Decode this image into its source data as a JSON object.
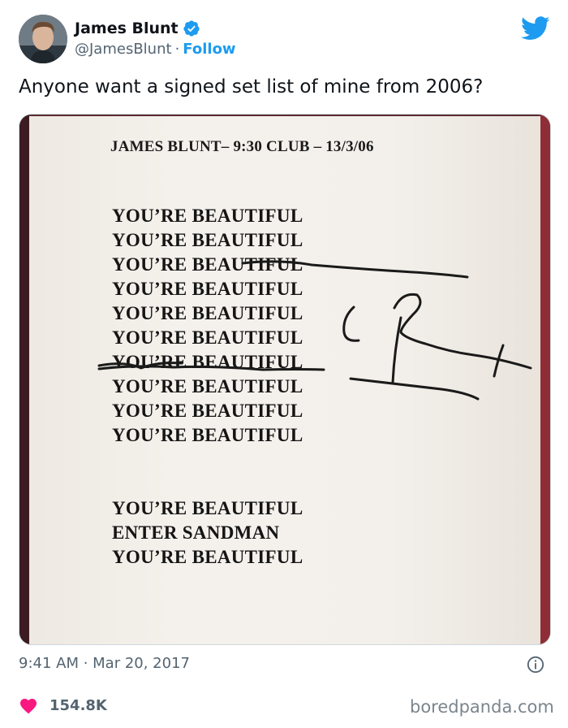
{
  "tweet": {
    "author_name": "James Blunt",
    "handle": "@JamesBlunt",
    "separator": "·",
    "follow_label": "Follow",
    "text": "Anyone want a signed set list of mine from 2006?",
    "timestamp": "9:41 AM · Mar 20, 2017",
    "likes": "154.8K"
  },
  "setlist": {
    "title": "JAMES BLUNT– 9:30 CLUB – 13/3/06",
    "songs": [
      "YOU’RE BEAUTIFUL",
      "YOU’RE BEAUTIFUL",
      "YOU’RE BEAUTIFUL",
      "YOU’RE BEAUTIFUL",
      "YOU’RE BEAUTIFUL",
      "YOU’RE BEAUTIFUL",
      "YOU’RE BEAUTIFUL",
      "YOU’RE BEAUTIFUL",
      "YOU’RE BEAUTIFUL",
      "YOU’RE BEAUTIFUL",
      "YOU’RE BEAUTIFUL",
      "ENTER SANDMAN",
      "YOU’RE BEAUTIFUL"
    ]
  },
  "icons": {
    "verified": "verified-badge-icon",
    "twitter": "twitter-bird-icon",
    "info": "info-icon",
    "like": "heart-icon"
  },
  "colors": {
    "accent": "#1d9bf0",
    "like": "#f91880",
    "muted": "#536471"
  },
  "watermark": "boredpanda.com"
}
